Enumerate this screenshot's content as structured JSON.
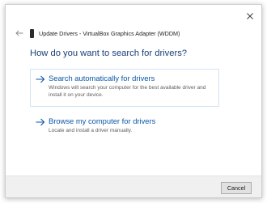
{
  "window": {
    "title": "Update Drivers - VirtualBox Graphics Adapter (WDDM)",
    "close_icon": "close-icon",
    "back_icon": "back-arrow-icon"
  },
  "main": {
    "heading": "How do you want to search for drivers?",
    "options": [
      {
        "title": "Search automatically for drivers",
        "description": "Windows will search your computer for the best available driver and install it on your device.",
        "icon": "arrow-right-icon",
        "state": "hovered"
      },
      {
        "title": "Browse my computer for drivers",
        "description": "Locate and install a driver manually.",
        "icon": "arrow-right-icon",
        "state": "normal"
      }
    ]
  },
  "footer": {
    "cancel_label": "Cancel"
  },
  "colors": {
    "heading": "#1a3e78",
    "link": "#0a57a8",
    "hover_border": "#cfe3f5",
    "footer_bg": "#f0f0f0"
  }
}
